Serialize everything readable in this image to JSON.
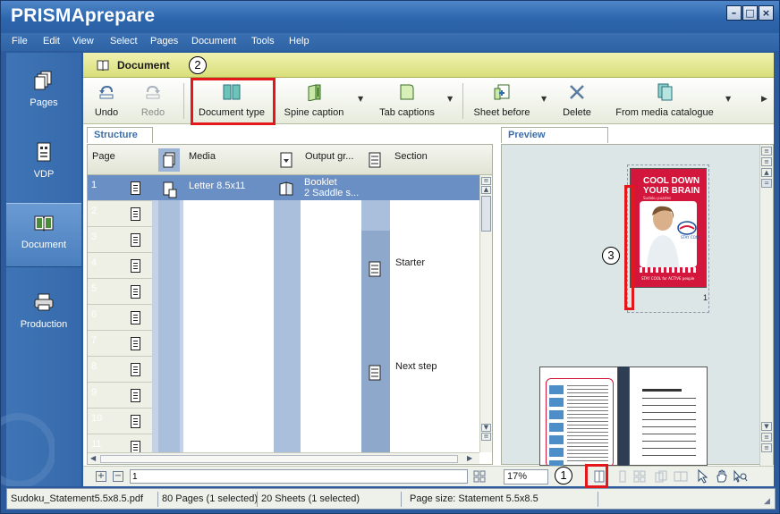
{
  "app": {
    "title": "PRISMAprepare"
  },
  "window_controls": {
    "minimize": "–",
    "maximize": "□",
    "close": "×"
  },
  "menu": [
    "File",
    "Edit",
    "View",
    "Select",
    "Pages",
    "Document",
    "Tools",
    "Help"
  ],
  "sidebar": {
    "items": [
      {
        "label": "Pages",
        "icon": "pages-icon",
        "active": false
      },
      {
        "label": "VDP",
        "icon": "vdp-icon",
        "active": false
      },
      {
        "label": "Document",
        "icon": "document-book-icon",
        "active": true
      },
      {
        "label": "Production",
        "icon": "printer-icon",
        "active": false
      }
    ]
  },
  "document_panel": {
    "title": "Document"
  },
  "ribbon": {
    "undo": "Undo",
    "redo": "Redo",
    "document_type": "Document type",
    "spine_caption": "Spine caption",
    "tab_captions": "Tab captions",
    "sheet_before": "Sheet before",
    "delete": "Delete",
    "from_media_catalogue": "From media catalogue"
  },
  "callouts": {
    "one": "1",
    "two": "2",
    "three": "3"
  },
  "structure": {
    "tab_label": "Structure",
    "columns": {
      "page": "Page",
      "media": "Media",
      "output": "Output gr...",
      "section": "Section"
    },
    "rows": [
      "1",
      "2",
      "3",
      "4",
      "5",
      "6",
      "7",
      "8",
      "9",
      "10",
      "11"
    ],
    "media_value": "Letter 8.5x11",
    "output_value_line1": "Booklet",
    "output_value_line2": "2 Saddle s...",
    "sections": [
      {
        "row": 4,
        "name": "Starter"
      },
      {
        "row": 8,
        "name": "Next step"
      }
    ],
    "page_input": "1"
  },
  "preview": {
    "tab_label": "Preview",
    "cover": {
      "headline1": "COOL DOWN",
      "headline2": "YOUR BRAIN",
      "subline": "Sudoku puzzles",
      "footer": "STAY COOL for ACTIVE people",
      "brand": "STAY COOL"
    },
    "page_number": "1",
    "zoom": "17%",
    "colors": {
      "cover_red": "#d3163c",
      "pane_bg": "#dde6e7"
    }
  },
  "status": {
    "file": "Sudoku_Statement5.5x8.5.pdf",
    "pages": "80 Pages (1 selected)",
    "sheets": "20 Sheets (1 selected)",
    "page_size": "Page size: Statement 5.5x8.5"
  }
}
